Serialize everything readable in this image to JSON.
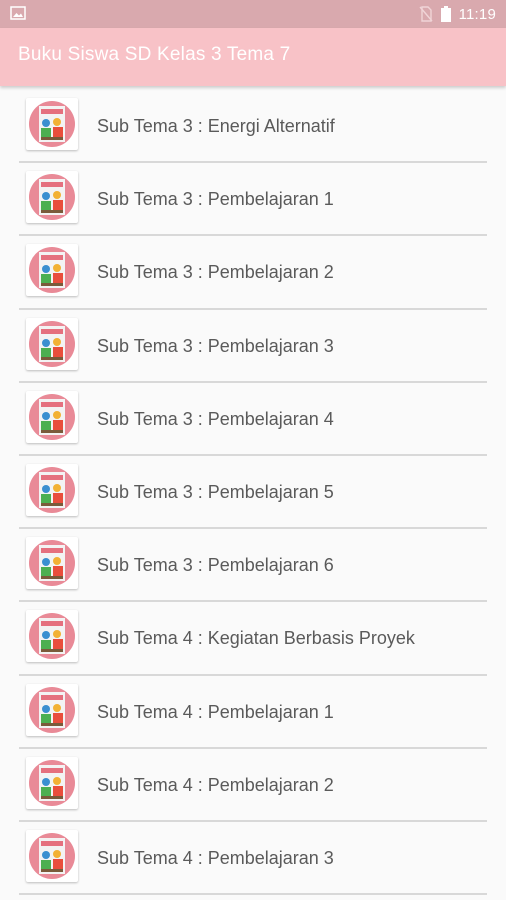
{
  "status_bar": {
    "time": "11:19",
    "left_icon": "image-icon",
    "sim_icon": "no-sim-icon",
    "battery_icon": "battery-icon"
  },
  "app_bar": {
    "title": "Buku Siswa SD Kelas 3 Tema 7",
    "color": "#f8c2c7"
  },
  "list": {
    "items": [
      {
        "label": "Sub Tema 3 : Energi Alternatif",
        "icon": "book-cover-icon"
      },
      {
        "label": "Sub Tema 3 : Pembelajaran 1",
        "icon": "book-cover-icon"
      },
      {
        "label": "Sub Tema 3 : Pembelajaran 2",
        "icon": "book-cover-icon"
      },
      {
        "label": "Sub Tema 3 : Pembelajaran 3",
        "icon": "book-cover-icon"
      },
      {
        "label": "Sub Tema 3 : Pembelajaran 4",
        "icon": "book-cover-icon"
      },
      {
        "label": "Sub Tema 3 : Pembelajaran 5",
        "icon": "book-cover-icon"
      },
      {
        "label": "Sub Tema 3 : Pembelajaran 6",
        "icon": "book-cover-icon"
      },
      {
        "label": "Sub Tema 4 : Kegiatan Berbasis Proyek",
        "icon": "book-cover-icon"
      },
      {
        "label": "Sub Tema 4 : Pembelajaran 1",
        "icon": "book-cover-icon"
      },
      {
        "label": "Sub Tema 4 : Pembelajaran 2",
        "icon": "book-cover-icon"
      },
      {
        "label": "Sub Tema 4 : Pembelajaran 3",
        "icon": "book-cover-icon"
      }
    ]
  }
}
